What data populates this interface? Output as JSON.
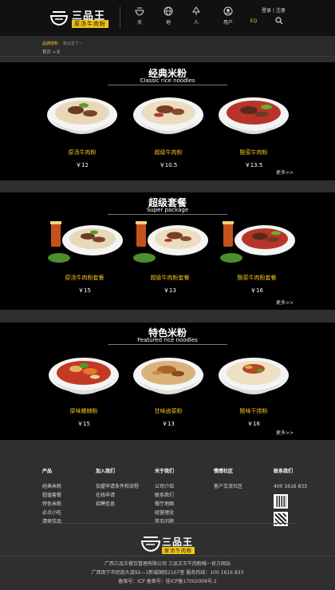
{
  "header": {
    "brand": "三品王",
    "brand_sub": "原汤牛肉粉",
    "nav": [
      {
        "label": "天",
        "icon": "bowl-icon"
      },
      {
        "label": "地",
        "icon": "globe-icon"
      },
      {
        "label": "人",
        "icon": "tree-icon"
      },
      {
        "label": "用户",
        "icon": "user-icon"
      },
      {
        "label": "EQ",
        "icon": "eq-icon"
      }
    ],
    "login": "登录",
    "register": "注册",
    "login_sep": "|"
  },
  "breadcrumb": {
    "current_top": "品牌搜粉",
    "top_hint": "我出发了~",
    "path": "首页 >天"
  },
  "sections": [
    {
      "title": "经典米粉",
      "subtitle": "Classic rice noodles",
      "more": "更多>>",
      "items": [
        {
          "name": "原汤牛肉粉",
          "price": "￥12"
        },
        {
          "name": "超级牛肉粉",
          "price": "￥10.5"
        },
        {
          "name": "酸菜牛肉粉",
          "price": "￥13.5"
        }
      ]
    },
    {
      "title": "超级套餐",
      "subtitle": "Super package",
      "more": "更多>>",
      "items": [
        {
          "name": "原汤牛肉粉套餐",
          "price": "￥15"
        },
        {
          "name": "超级牛肉粉套餐",
          "price": "￥13"
        },
        {
          "name": "酸菜牛肉粉套餐",
          "price": "￥16"
        }
      ]
    },
    {
      "title": "特色米粉",
      "subtitle": "Featured rice noodles",
      "more": "更多>>",
      "items": [
        {
          "name": "厚味螺蛳粉",
          "price": "￥15"
        },
        {
          "name": "甘味卤菜粉",
          "price": "￥13"
        },
        {
          "name": "酸味干捞粉",
          "price": "￥16"
        }
      ]
    }
  ],
  "footer": {
    "columns": [
      {
        "title": "产品",
        "links": [
          "经典米粉",
          "超值套餐",
          "特色米粉",
          "必点小吃",
          "清爽饮品"
        ]
      },
      {
        "title": "加入我们",
        "links": [
          "加盟申请条件和流程",
          "在线申请",
          "招聘信息"
        ]
      },
      {
        "title": "关于我们",
        "links": [
          "公司介绍",
          "联系我们",
          "餐厅地图",
          "经营理念",
          "常见问题"
        ]
      },
      {
        "title": "情感社区",
        "links": [
          "客户交流社区"
        ]
      },
      {
        "title": "联系我们",
        "links": [
          "400 1616 833"
        ]
      }
    ],
    "company_line": "广西三品王餐饮管理有限公司 三品王王牛肉粉唯一官方网站",
    "address_line": "广西南宁市民族大道92—1新城国际2107室 服务热线：100 1616 833",
    "icp_line": "备案号：ICP   备案号：桂ICP备17002009号-1"
  },
  "colors": {
    "accent": "#f0c419",
    "bg": "#2f2f2f",
    "section_bg": "#000000"
  }
}
